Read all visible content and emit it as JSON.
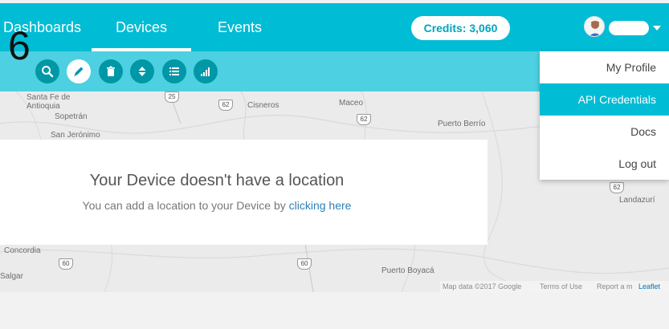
{
  "nav": {
    "tabs": [
      "Dashboards",
      "Devices",
      "Events"
    ],
    "active_tab": "Devices",
    "credits_label": "Credits: 3,060",
    "annotation_number": "6"
  },
  "toolbar": {
    "buttons": [
      "search-icon",
      "pencil-icon",
      "trash-icon",
      "sort-icon",
      "list-icon",
      "signal-icon"
    ],
    "selected": "pencil-icon"
  },
  "user_menu": {
    "items": [
      "My Profile",
      "API Credentials",
      "Docs",
      "Log out"
    ],
    "highlighted": "API Credentials"
  },
  "map": {
    "places": [
      "Santa Fe de Antioquia",
      "Sopetrán",
      "San Jerónimo",
      "Cisneros",
      "Maceo",
      "Puerto Berrío",
      "Landazurí",
      "Concordia",
      "Salgar",
      "Puerto Boyacá"
    ],
    "routes": [
      "25",
      "62",
      "62",
      "62",
      "60",
      "60"
    ],
    "attribution": {
      "map_data": "Map data ©2017 Google",
      "terms": "Terms of Use",
      "report": "Report a m",
      "leaflet": "Leaflet"
    }
  },
  "empty_state": {
    "title": "Your Device doesn't have a location",
    "text": "You can add a location to your Device by ",
    "link": "clicking here"
  },
  "colors": {
    "nav": "#00bcd4",
    "toolbar": "#4dd0e1",
    "tool_button": "#0097a7",
    "menu_highlight": "#00bcd4"
  }
}
